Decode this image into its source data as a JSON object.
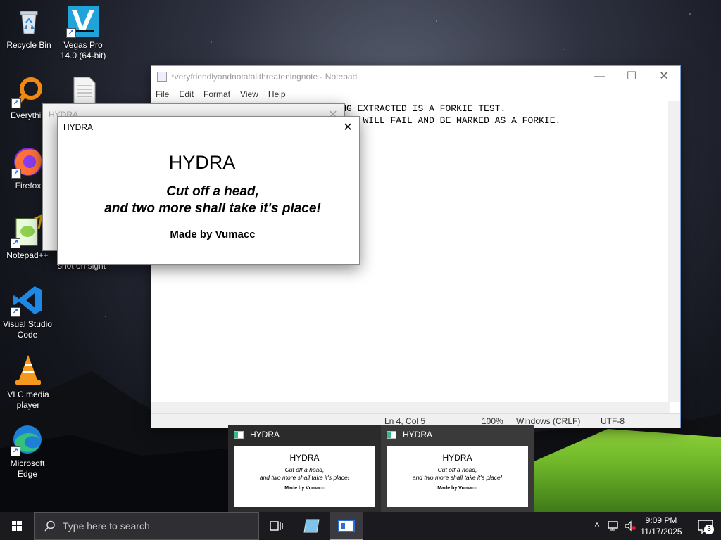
{
  "desktop": {
    "icons": [
      {
        "label": "Recycle Bin",
        "icon": "recycle-bin-icon"
      },
      {
        "label": "Vegas Pro 14.0 (64-bit)",
        "icon": "vegas-pro-icon"
      },
      {
        "label": "Everythin",
        "icon": "everything-search-icon"
      },
      {
        "label": "Firefox",
        "icon": "firefox-icon"
      },
      {
        "label": "Notepad++",
        "icon": "notepadpp-icon"
      },
      {
        "label": "Visual Studio Code",
        "icon": "vscode-icon"
      },
      {
        "label": "VLC media player",
        "icon": "vlc-icon"
      },
      {
        "label": "Microsoft Edge",
        "icon": "edge-icon"
      }
    ],
    "partial_label": "shot on sight"
  },
  "notepad": {
    "title": "*veryfriendlyandnotatallthreateningnote - Notepad",
    "menu": [
      "File",
      "Edit",
      "Format",
      "View",
      "Help"
    ],
    "line1": "ANY MALWARE BEING EXTRACTED IS A FORKIE TEST.",
    "line2": "IF YOU RUN IT, YOU WILL FAIL AND BE MARKED AS A FORKIE.",
    "visible_line1": "                                  NG EXTRACTED IS A FORKIE TEST.",
    "visible_line2": "                                   OU WILL FAIL AND BE MARKED AS A FORKIE.",
    "status": {
      "position": "Ln 4, Col 5",
      "zoom": "100%",
      "line_ending": "Windows (CRLF)",
      "encoding": "UTF-8"
    }
  },
  "hydra_back": {
    "title": "HYDRA"
  },
  "hydra_front": {
    "title": "HYDRA",
    "heading": "HYDRA",
    "subtitle_line1": "Cut off a head,",
    "subtitle_line2": "and two more shall take it's place!",
    "credit": "Made by Vumacc"
  },
  "thumbnails": [
    {
      "title": "HYDRA",
      "heading": "HYDRA",
      "line1": "Cut off a head,",
      "line2": "and two more shall take it's place!",
      "credit": "Made by Vumacc"
    },
    {
      "title": "HYDRA",
      "heading": "HYDRA",
      "line1": "Cut off a head,",
      "line2": "and two more shall take it's place!",
      "credit": "Made by Vumacc"
    }
  ],
  "taskbar": {
    "search_placeholder": "Type here to search",
    "time": "9:09 PM",
    "date": "11/17/2025",
    "notification_count": "3"
  },
  "colors": {
    "accent": "#7fb0ff",
    "taskbar": "#1b1b1f",
    "vscode_blue": "#1e88e5"
  }
}
